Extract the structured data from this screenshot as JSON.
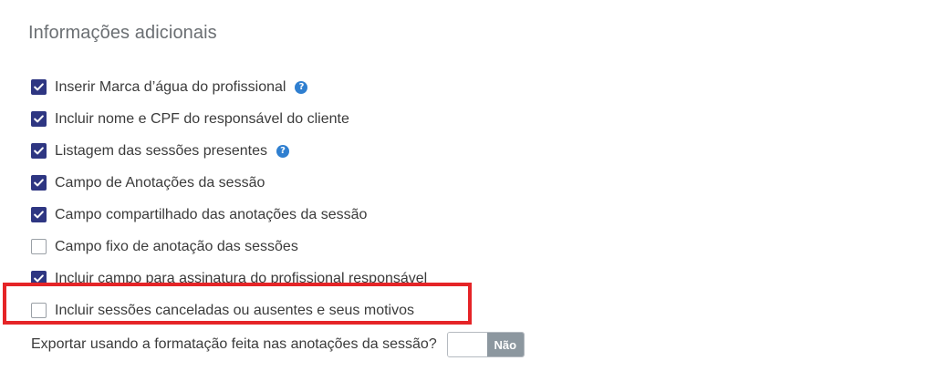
{
  "section": {
    "title": "Informações adicionais"
  },
  "options": [
    {
      "label": "Inserir Marca d’água do profissional",
      "checked": true,
      "help": true
    },
    {
      "label": "Incluir nome e CPF do responsável do cliente",
      "checked": true,
      "help": false
    },
    {
      "label": "Listagem das sessões presentes",
      "checked": true,
      "help": true
    },
    {
      "label": "Campo de Anotações da sessão",
      "checked": true,
      "help": false
    },
    {
      "label": "Campo compartilhado das anotações da sessão",
      "checked": true,
      "help": false
    },
    {
      "label": "Campo fixo de anotação das sessões",
      "checked": false,
      "help": false
    },
    {
      "label": "Incluir campo para assinatura do profissional responsável",
      "checked": true,
      "help": false
    },
    {
      "label": "Incluir sessões canceladas ou ausentes e seus motivos",
      "checked": false,
      "help": false
    }
  ],
  "help_icon_glyph": "?",
  "export": {
    "label": "Exportar usando a formatação feita nas anotações da sessão?",
    "toggle_label": "Não",
    "enabled": false
  },
  "colors": {
    "checkbox_checked": "#2e3682",
    "help_icon": "#2f7fd0",
    "highlight": "#e52427",
    "toggle_off": "#8c979f"
  },
  "icons": {
    "check": "checkmark-icon",
    "help": "question-circle-icon"
  }
}
